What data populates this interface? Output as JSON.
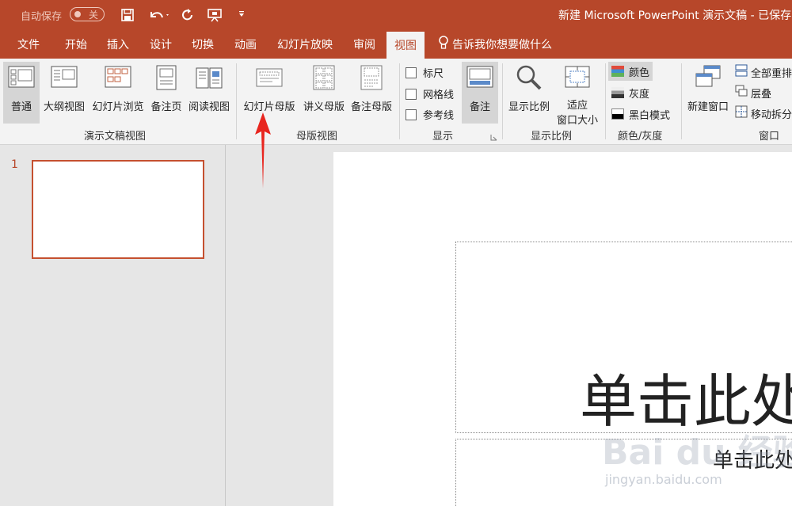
{
  "titlebar": {
    "autosave_label": "自动保存",
    "autosave_state": "关",
    "doc_title": "新建 Microsoft PowerPoint 演示文稿 - 已保存",
    "quick_access_icons": [
      "save-icon",
      "undo-icon",
      "redo-icon",
      "slideshow-from-start-icon",
      "customize-dropdown-icon"
    ]
  },
  "tabs": [
    "文件",
    "开始",
    "插入",
    "设计",
    "切换",
    "动画",
    "幻灯片放映",
    "审阅",
    "视图"
  ],
  "active_tab": "视图",
  "tell_me": "告诉我你想要做什么",
  "ribbon": {
    "presentation_views": {
      "group_label": "演示文稿视图",
      "buttons": [
        "普通",
        "大纲视图",
        "幻灯片浏览",
        "备注页",
        "阅读视图"
      ]
    },
    "master_views": {
      "group_label": "母版视图",
      "buttons": [
        "幻灯片母版",
        "讲义母版",
        "备注母版"
      ]
    },
    "show": {
      "group_label": "显示",
      "checkboxes": [
        "标尺",
        "网格线",
        "参考线"
      ],
      "notes_button": "备注"
    },
    "zoom": {
      "group_label": "显示比例",
      "zoom_button": "显示比例",
      "fit_line1": "适应",
      "fit_line2": "窗口大小"
    },
    "color": {
      "group_label": "颜色/灰度",
      "buttons": [
        "颜色",
        "灰度",
        "黑白模式"
      ]
    },
    "window": {
      "group_label": "窗口",
      "new_window": "新建窗口",
      "buttons": [
        "全部重排",
        "层叠",
        "移动拆分"
      ]
    }
  },
  "slides_pane": {
    "slide_number": "1"
  },
  "slide": {
    "title_placeholder": "单击此处",
    "subtitle_placeholder": "单击此处"
  },
  "watermark": {
    "line1": "Bai du 经验",
    "line2": "jingyan.baidu.com"
  },
  "colors": {
    "brand": "#b7472a",
    "ribbon_bg": "#f3f3f3",
    "selected_bg": "#d5d5d5",
    "annotation_arrow": "#e8261f"
  }
}
